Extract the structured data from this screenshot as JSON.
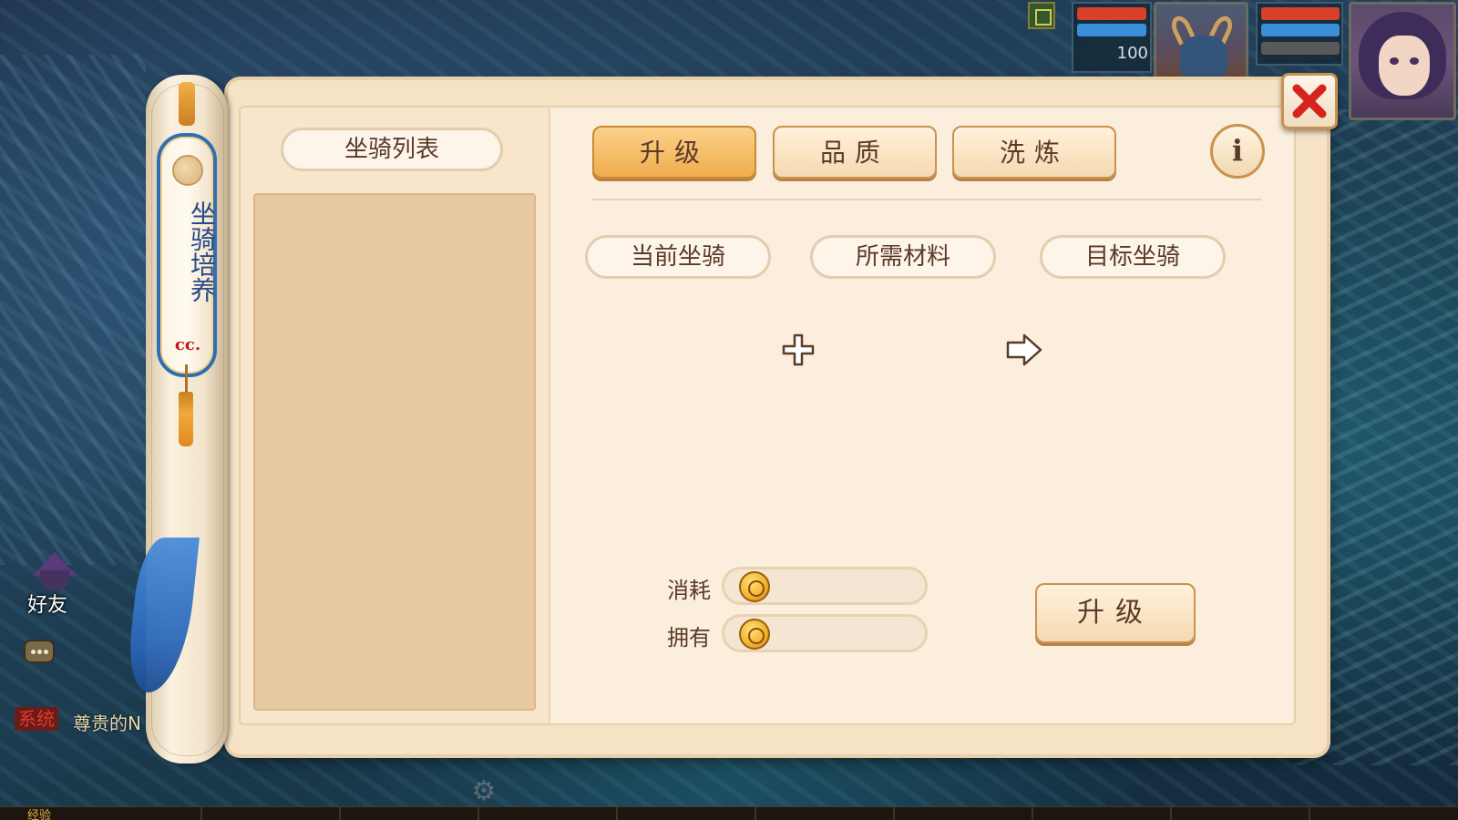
{
  "hud": {
    "pet_level": "100",
    "bar_colors": {
      "hp": "#d8402a",
      "mp": "#3a8fd8"
    }
  },
  "side_scroll": {
    "title": "坐骑培养",
    "stamp": "cc."
  },
  "mount_list": {
    "title": "坐骑列表"
  },
  "tabs": [
    {
      "label": "升级",
      "active": true
    },
    {
      "label": "品质",
      "active": false
    },
    {
      "label": "洗炼",
      "active": false
    }
  ],
  "info_icon": "i",
  "sections": {
    "current": "当前坐骑",
    "materials": "所需材料",
    "target": "目标坐骑"
  },
  "cost": {
    "consume_label": "消耗",
    "consume_value": "",
    "own_label": "拥有",
    "own_value": ""
  },
  "upgrade_button": "升级",
  "left_hud": {
    "friend_label": "好友",
    "system_tag": "系统",
    "system_message": "尊贵的N",
    "exp_label": "经验"
  },
  "colors": {
    "accent": "#f0ad4e",
    "close_x": "#d6231c",
    "scroll_border": "#2f6fb0"
  }
}
